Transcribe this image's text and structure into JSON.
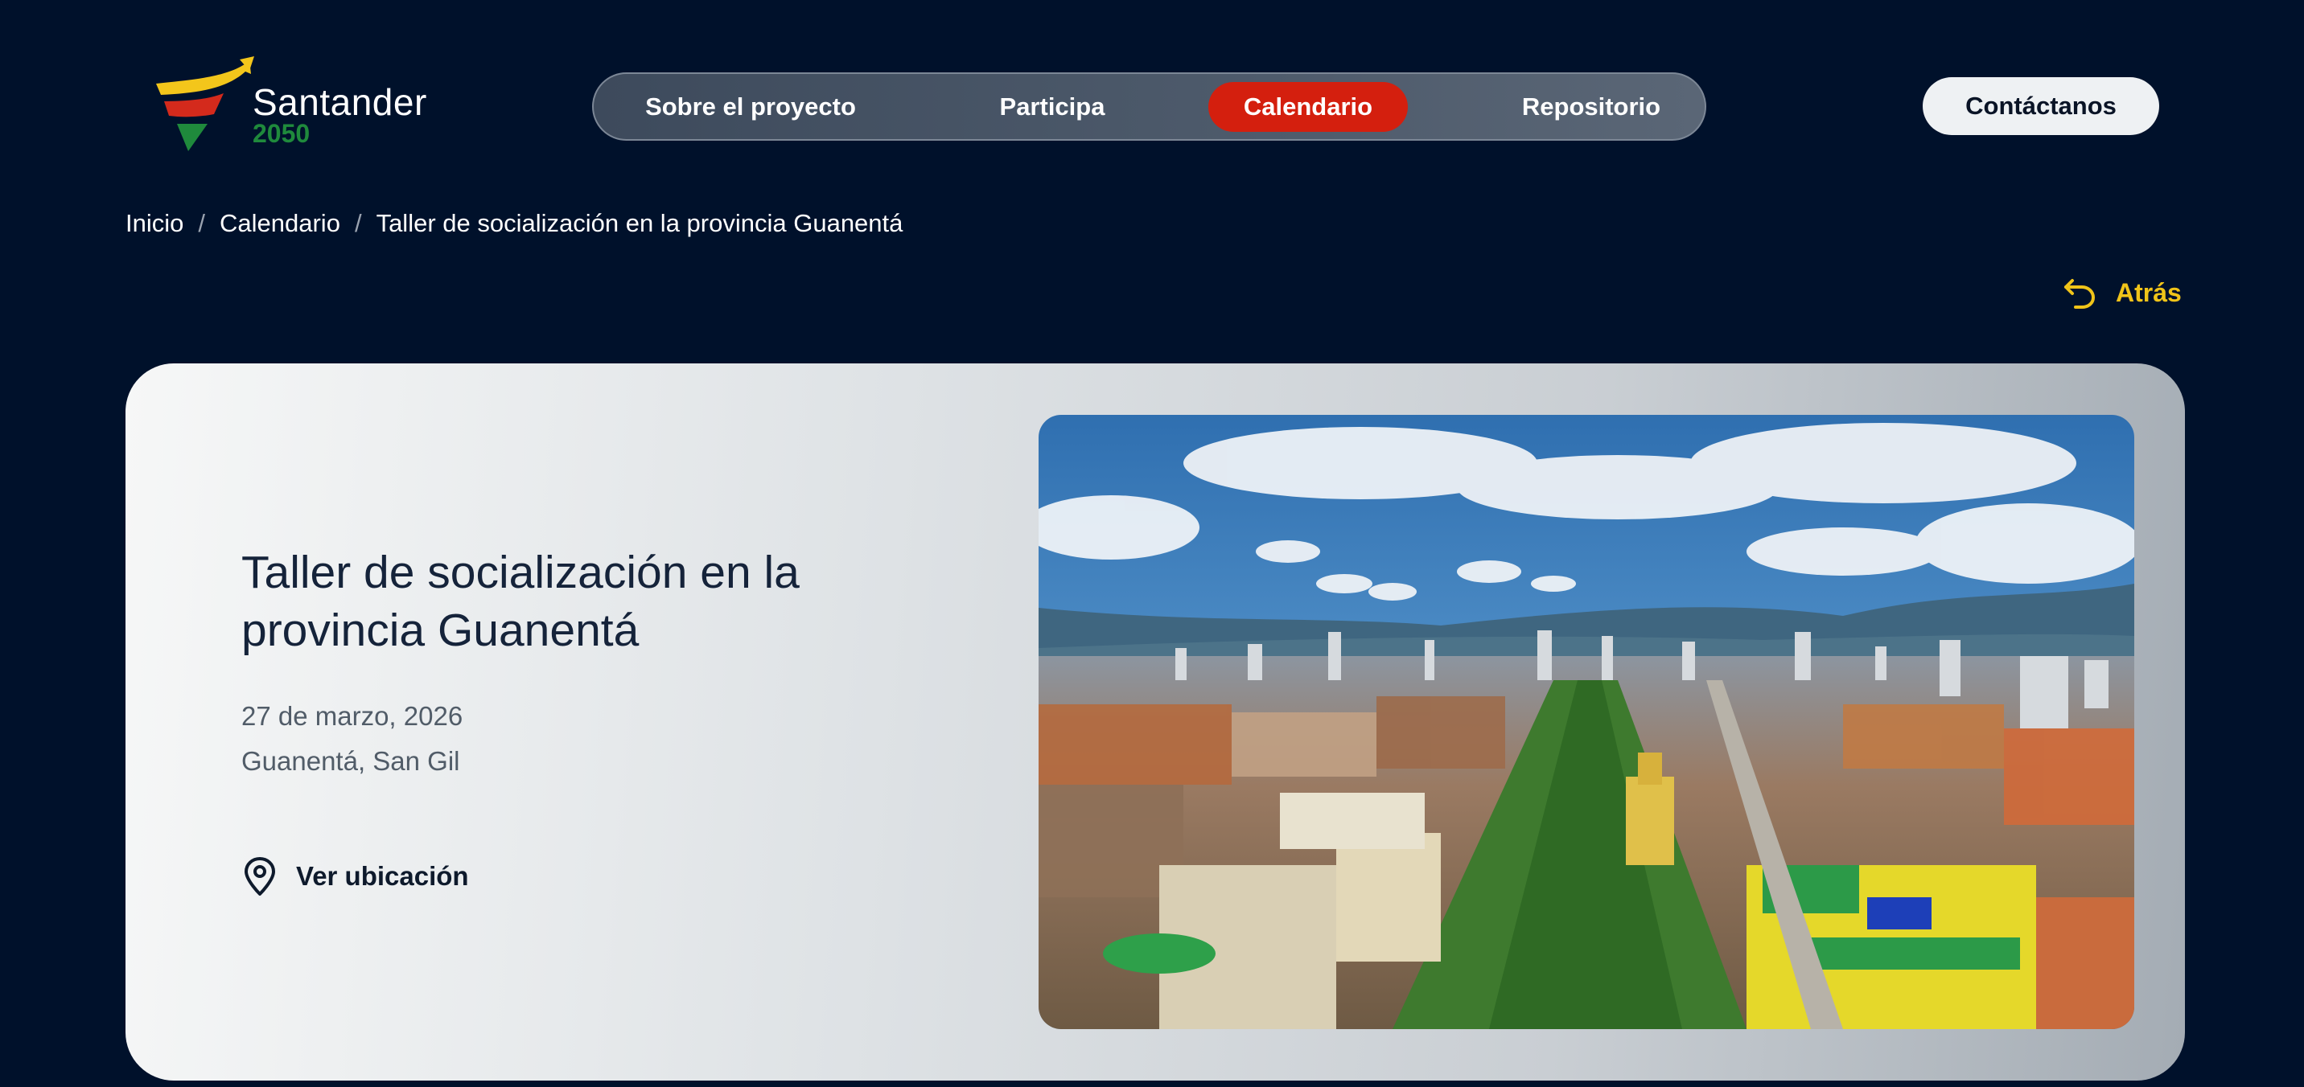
{
  "brand": {
    "name": "Santander",
    "year": "2050"
  },
  "nav": {
    "items": [
      {
        "label": "Sobre el proyecto",
        "active": false
      },
      {
        "label": "Participa",
        "active": false
      },
      {
        "label": "Calendario",
        "active": true
      },
      {
        "label": "Repositorio",
        "active": false
      }
    ],
    "contact_label": "Contáctanos"
  },
  "breadcrumb": {
    "items": [
      "Inicio",
      "Calendario",
      "Taller de socialización en la provincia Guanentá"
    ],
    "separator": "/"
  },
  "back": {
    "label": "Atrás",
    "icon": "undo-arrow-icon"
  },
  "event": {
    "title": "Taller de socialización en la provincia Guanentá",
    "date": "27 de marzo, 2026",
    "place": "Guanentá, San Gil",
    "location_link": "Ver ubicación",
    "location_icon": "map-pin-icon",
    "image": "aerial-city-photo"
  },
  "colors": {
    "background": "#00112b",
    "active_nav": "#d41f0e",
    "back_accent": "#f0c419",
    "brand_green": "#1f8a3c",
    "brand_yellow": "#f3c61b",
    "brand_red": "#d42a1c"
  }
}
